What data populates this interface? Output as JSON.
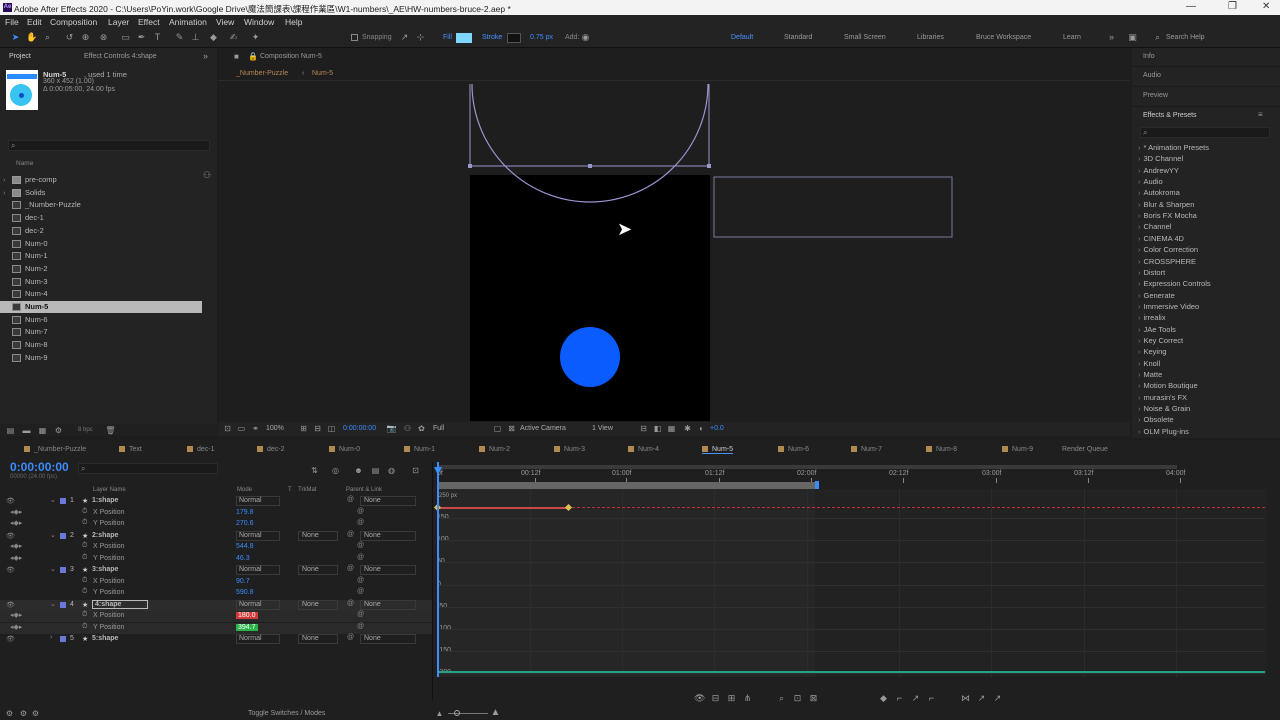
{
  "window": {
    "title": "Adobe After Effects 2020 - C:\\Users\\PoYin.work\\Google Drive\\魔法簡課表\\課程作業區\\W1-numbers\\_AE\\HW-numbers-bruce-2.aep *",
    "controls": [
      "—",
      "❐",
      "✕"
    ]
  },
  "menu": [
    "File",
    "Edit",
    "Composition",
    "Layer",
    "Effect",
    "Animation",
    "View",
    "Window",
    "Help"
  ],
  "toolbar": {
    "snapping": "Snapping",
    "fill": "Fill",
    "stroke": "Stroke",
    "stroke_width": "0.75 px",
    "add": "Add:",
    "workspaces": [
      "Default",
      "Standard",
      "Small Screen",
      "Libraries",
      "Bruce Workspace",
      "Learn"
    ],
    "search": "Search Help",
    "colors": {
      "fill": "#7fd6ff",
      "accent": "#3a8cff"
    }
  },
  "project": {
    "tab_project": "Project",
    "tab_effect_controls": "Effect Controls 4:shape",
    "comp_name": "Num-5",
    "used": ", used 1 time",
    "dims": "360 x 452 (1.00)",
    "duration": "Δ 0:00:05:00, 24.00 fps",
    "col_name": "Name",
    "bpc": "8 bpc",
    "items": [
      {
        "label": "pre-comp",
        "type": "folder"
      },
      {
        "label": "Solids",
        "type": "folder"
      },
      {
        "label": "_Number-Puzzle",
        "type": "comp"
      },
      {
        "label": "dec-1",
        "type": "comp"
      },
      {
        "label": "dec-2",
        "type": "comp"
      },
      {
        "label": "Num-0",
        "type": "comp"
      },
      {
        "label": "Num-1",
        "type": "comp"
      },
      {
        "label": "Num-2",
        "type": "comp"
      },
      {
        "label": "Num-3",
        "type": "comp"
      },
      {
        "label": "Num-4",
        "type": "comp"
      },
      {
        "label": "Num-5",
        "type": "comp",
        "selected": true
      },
      {
        "label": "Num-6",
        "type": "comp"
      },
      {
        "label": "Num-7",
        "type": "comp"
      },
      {
        "label": "Num-8",
        "type": "comp"
      },
      {
        "label": "Num-9",
        "type": "comp"
      }
    ]
  },
  "composition": {
    "tab": "Composition Num-5",
    "breadcrumb_parent": "_Number-Puzzle",
    "breadcrumb_current": "Num-5",
    "zoom": "100%",
    "timecode": "0:00:00:00",
    "resolution": "Full",
    "camera": "Active Camera",
    "view": "1 View",
    "exposure": "+0.0",
    "circle_color": "#0a5cff"
  },
  "right_panel": {
    "info": "Info",
    "audio": "Audio",
    "preview": "Preview",
    "effects_title": "Effects & Presets",
    "effects": [
      "* Animation Presets",
      "3D Channel",
      "AndrewYY",
      "Audio",
      "Autokroma",
      "Blur & Sharpen",
      "Boris FX Mocha",
      "Channel",
      "CINEMA 4D",
      "Color Correction",
      "CROSSPHERE",
      "Distort",
      "Expression Controls",
      "Generate",
      "Immersive Video",
      "irrealix",
      "JAe Tools",
      "Key Correct",
      "Keying",
      "Knoll",
      "Matte",
      "Motion Boutique",
      "murasin's FX",
      "Noise & Grain",
      "Obsolete",
      "OLM Plug-ins"
    ]
  },
  "timeline": {
    "tabs": [
      "_Number-Puzzle",
      "Text",
      "dec-1",
      "dec-2",
      "Num-0",
      "Num-1",
      "Num-2",
      "Num-3",
      "Num-4",
      "Num-5",
      "Num-6",
      "Num-7",
      "Num-8",
      "Num-9",
      "Render Queue"
    ],
    "active_tab": "Num-5",
    "timecode": "0:00:00:00",
    "fps_sub": "00000 (24.00 fps)",
    "columns": {
      "layer_name": "Layer Name",
      "mode": "Mode",
      "t": "T",
      "trkmat": "TrkMat",
      "parent": "Parent & Link"
    },
    "layers": [
      {
        "num": "1",
        "name": "1:shape",
        "mode": "Normal",
        "trkmat": "",
        "parent": "None",
        "props": [
          {
            "name": "X Position",
            "value": "179.8"
          },
          {
            "name": "Y Position",
            "value": "270.6"
          }
        ]
      },
      {
        "num": "2",
        "name": "2:shape",
        "mode": "Normal",
        "trkmat": "None",
        "parent": "None",
        "props": [
          {
            "name": "X Position",
            "value": "544.8"
          },
          {
            "name": "Y Position",
            "value": "46.3"
          }
        ]
      },
      {
        "num": "3",
        "name": "3:shape",
        "mode": "Normal",
        "trkmat": "None",
        "parent": "None",
        "props": [
          {
            "name": "X Position",
            "value": "90.7"
          },
          {
            "name": "Y Position",
            "value": "590.8"
          }
        ]
      },
      {
        "num": "4",
        "name": "4:shape",
        "mode": "Normal",
        "trkmat": "None",
        "parent": "None",
        "props": [
          {
            "name": "X Position",
            "value": "180.0"
          },
          {
            "name": "Y Position",
            "value": "394.7"
          }
        ]
      },
      {
        "num": "5",
        "name": "5:shape",
        "mode": "Normal",
        "trkmat": "None",
        "parent": "None",
        "props": []
      }
    ],
    "ruler": [
      "0f",
      "00:12f",
      "01:00f",
      "01:12f",
      "02:00f",
      "02:12f",
      "03:00f",
      "03:12f",
      "04:00f"
    ],
    "graph_unit": "250 px",
    "graph_labels": [
      "150",
      "100",
      "50",
      "0",
      "-50",
      "-100",
      "-150",
      "-200"
    ],
    "toggle": "Toggle Switches / Modes"
  }
}
